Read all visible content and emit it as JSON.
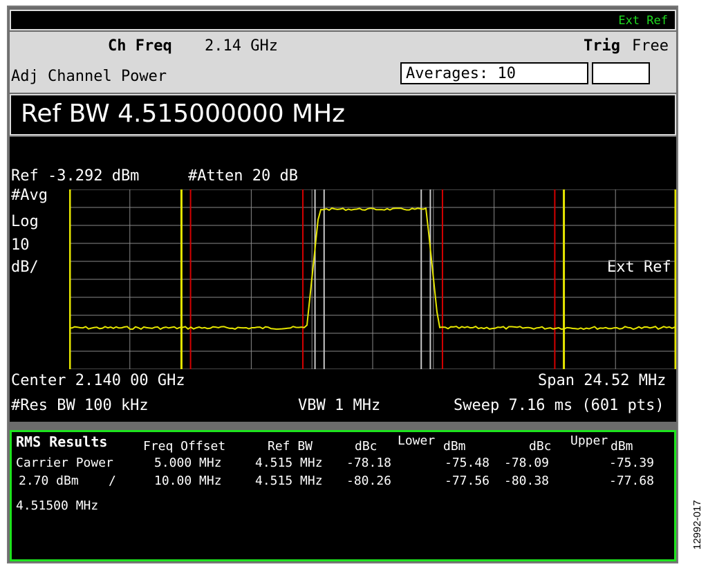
{
  "header": {
    "ext_ref": "Ext Ref"
  },
  "info": {
    "ch_freq_label": "Ch Freq",
    "ch_freq_value": "2.14 GHz",
    "trig_label": "Trig",
    "trig_value": "Free",
    "mode": "Adj Channel Power",
    "averages": "Averages: 10"
  },
  "ref_bw_bar": "Ref BW 4.515000000 MHz",
  "screen": {
    "ref_level": "Ref -3.292 dBm",
    "atten": "#Atten 20 dB",
    "avg": "#Avg",
    "scale_type": "Log",
    "scale_value": "10",
    "scale_unit": "dB/",
    "ext_ref": "Ext Ref",
    "center": "Center 2.140 00 GHz",
    "span": "Span 24.52 MHz",
    "res_bw": "#Res BW 100 kHz",
    "vbw": "VBW 1 MHz",
    "sweep": "Sweep 7.16 ms (601 pts)"
  },
  "trace": {
    "unit": "dB",
    "noise_floor_div": 7.7,
    "carrier_top_div": 1.1,
    "carrier_from_div": 4.05,
    "carrier_to_div": 5.95,
    "yellow_markers_div": [
      0,
      1.85,
      8.15,
      10
    ],
    "red_markers_div": [
      2.0,
      3.85,
      6.15,
      8.0
    ],
    "white_markers_div": [
      4.05,
      4.2,
      5.8,
      5.95
    ],
    "colors": {
      "trace": "#e6e600",
      "grid": "#8a8a8a",
      "yellow": "#e6e600",
      "red": "#d40000",
      "white": "#c8c8c8"
    }
  },
  "results": {
    "title": "RMS Results",
    "carrier_power_label": "Carrier Power",
    "carrier_power_value": "2.70 dBm",
    "slash": "/",
    "carrier_bw": "4.51500 MHz",
    "headers": {
      "freq_offset": "Freq Offset",
      "ref_bw": "Ref BW",
      "lower": "Lower",
      "upper": "Upper",
      "dbc": "dBc",
      "dbm": "dBm"
    },
    "rows": [
      {
        "offset": "5.000 MHz",
        "ref_bw": "4.515 MHz",
        "lower_dbc": "-78.18",
        "lower_dbm": "-75.48",
        "upper_dbc": "-78.09",
        "upper_dbm": "-75.39"
      },
      {
        "offset": "10.00 MHz",
        "ref_bw": "4.515 MHz",
        "lower_dbc": "-80.26",
        "lower_dbm": "-77.56",
        "upper_dbc": "-80.38",
        "upper_dbm": "-77.68"
      }
    ]
  },
  "figure_code": "12992-017"
}
